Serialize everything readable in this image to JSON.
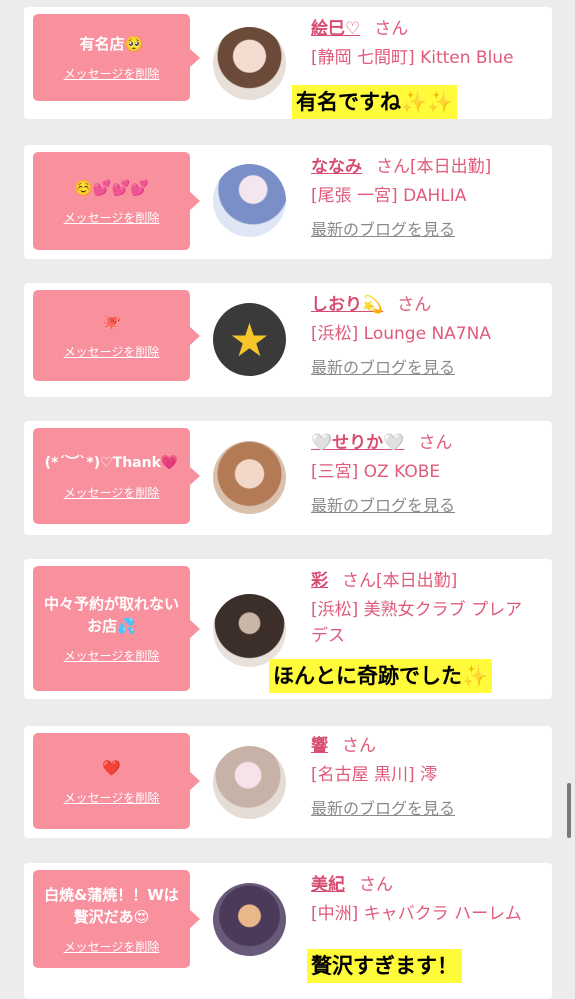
{
  "delete_label": "メッセージを削除",
  "blog_label": "最新のブログを見る",
  "san_label": "さん",
  "cards": [
    {
      "message": "有名店🥺",
      "name": "絵巳♡",
      "status": "",
      "shop": "[静岡 七間町] Kitten Blue",
      "highlight": "有名ですね✨✨"
    },
    {
      "message": "☺️💕💕💕",
      "name": "ななみ",
      "status": "[本日出勤]",
      "shop": "[尾張 一宮] DAHLIA"
    },
    {
      "message": "🐙",
      "name": "しおり💫",
      "status": "",
      "shop": "[浜松] Lounge NA7NA"
    },
    {
      "message": "(*´︶`*)♡Thank💗",
      "name": "🤍せりか🤍",
      "status": "",
      "shop": "[三宮] OZ KOBE"
    },
    {
      "message": "中々予約が取れないお店💦",
      "name": "彩",
      "status": "[本日出勤]",
      "shop": "[浜松] 美熟女クラブ プレアデス",
      "highlight": "ほんとに奇跡でした✨"
    },
    {
      "message": "❤️",
      "name": "響",
      "status": "",
      "shop": "[名古屋 黒川] 澪"
    },
    {
      "message": "白焼&蒲焼！！Wは贅沢だあ😍",
      "name": "美紀",
      "status": "",
      "shop": "[中洲] キャバクラ ハーレム",
      "highlight": "贅沢すぎます！"
    }
  ],
  "colors": {
    "accent": "#f8909e",
    "name": "#d94c72",
    "highlight": "#fffb3a",
    "background": "#ececee"
  }
}
